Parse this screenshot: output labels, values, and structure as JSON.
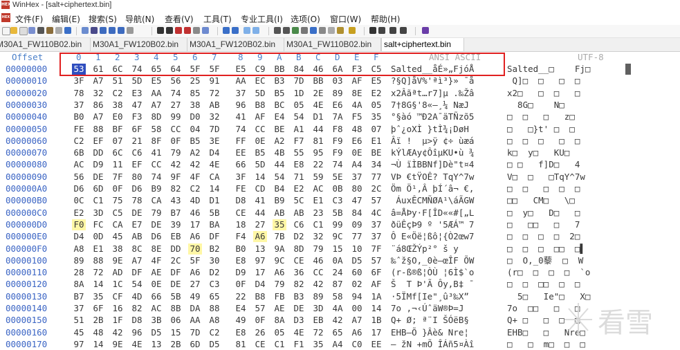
{
  "window": {
    "title": "WinHex - [salt+ciphertext.bin]"
  },
  "menu": [
    "文件(F)",
    "编辑(E)",
    "搜索(S)",
    "导航(N)",
    "查看(V)",
    "工具(T)",
    "专业工具(I)",
    "选项(O)",
    "窗口(W)",
    "帮助(H)"
  ],
  "tabs": [
    {
      "label": "M30A1_FW110B02.bin"
    },
    {
      "label": "M30A1_FW120B02.bin"
    },
    {
      "label": "M30A1_FW120B02.bin"
    },
    {
      "label": "M30A1_FW110B02.bin"
    },
    {
      "label": "salt+ciphertext.bin"
    }
  ],
  "header": {
    "offset_label": "Offset",
    "cols": [
      "0",
      "1",
      "2",
      "3",
      "4",
      "5",
      "6",
      "7",
      "8",
      "9",
      "A",
      "B",
      "C",
      "D",
      "E",
      "F"
    ],
    "ansi_label": "ANSI ASCII",
    "utf_label": "UTF-8"
  },
  "rows": [
    {
      "off": "00000000",
      "hex": [
        "53",
        "61",
        "6C",
        "74",
        "65",
        "64",
        "5F",
        "5F",
        "E5",
        "C9",
        "BB",
        "84",
        "46",
        "6A",
        "F3",
        "C5"
      ],
      "ansi": "Salted__åÉ»„FjóÅ",
      "utf": "Salted__□    Fj□"
    },
    {
      "off": "00000010",
      "hex": [
        "3F",
        "A7",
        "51",
        "5D",
        "E5",
        "56",
        "25",
        "91",
        "AA",
        "EC",
        "B3",
        "7D",
        "BB",
        "03",
        "AF",
        "E5"
      ],
      "ansi": "?§Q]åV%'ªì³}» ¯å",
      "utf": " Q]□  □   □  □"
    },
    {
      "off": "00000020",
      "hex": [
        "78",
        "32",
        "C2",
        "E3",
        "AA",
        "74",
        "85",
        "72",
        "37",
        "5D",
        "B5",
        "1D",
        "2E",
        "89",
        "8E",
        "E2"
      ],
      "ansi": "x2Âãªt…r7]µ .‰Žâ",
      "utf": "x2□   □  □   □"
    },
    {
      "off": "00000030",
      "hex": [
        "37",
        "86",
        "38",
        "47",
        "A7",
        "27",
        "38",
        "AB",
        "96",
        "B8",
        "BC",
        "05",
        "4E",
        "E6",
        "4A",
        "05"
      ],
      "ansi": "7†8G§'8«–¸¼ NæJ",
      "utf": "  8G□    N□"
    },
    {
      "off": "00000040",
      "hex": [
        "B0",
        "A7",
        "E0",
        "F3",
        "8D",
        "99",
        "D0",
        "32",
        "41",
        "AF",
        "E4",
        "54",
        "D1",
        "7A",
        "F5",
        "35"
      ],
      "ansi": "°§àó ™Ð2A¯äTÑzõ5",
      "utf": "□  □   □   z□"
    },
    {
      "off": "00000050",
      "hex": [
        "FE",
        "88",
        "BF",
        "6F",
        "58",
        "CC",
        "04",
        "7D",
        "74",
        "CC",
        "BE",
        "A1",
        "44",
        "F8",
        "48",
        "07"
      ],
      "ansi": "þˆ¿oXÌ }tÌ¾¡DøH",
      "utf": "□   □}t' □  □"
    },
    {
      "off": "00000060",
      "hex": [
        "C2",
        "EF",
        "07",
        "21",
        "8F",
        "0F",
        "B5",
        "3E",
        "FF",
        "0E",
        "A2",
        "F7",
        "81",
        "F9",
        "E6",
        "E1"
      ],
      "ansi": "Âï !  µ>ÿ ¢÷ ùæá",
      "utf": "□  □  □   □  □"
    },
    {
      "off": "00000070",
      "hex": [
        "6B",
        "DD",
        "6C",
        "C6",
        "41",
        "79",
        "A2",
        "D4",
        "EE",
        "B5",
        "4B",
        "55",
        "95",
        "F9",
        "0E",
        "BE"
      ],
      "ansi": "kÝlÆAy¢ÔîµKU•ù ¾",
      "utf": "k□  y□   KU□"
    },
    {
      "off": "00000080",
      "hex": [
        "AC",
        "D9",
        "11",
        "EF",
        "CC",
        "42",
        "42",
        "4E",
        "66",
        "5D",
        "44",
        "E8",
        "22",
        "74",
        "A4",
        "34"
      ],
      "ansi": "¬Ù ïÌBBNf]Dè\"t¤4",
      "utf": "□ □   f]D□   4"
    },
    {
      "off": "00000090",
      "hex": [
        "56",
        "DE",
        "7F",
        "80",
        "74",
        "9F",
        "4F",
        "CA",
        "3F",
        "14",
        "54",
        "71",
        "59",
        "5E",
        "37",
        "77"
      ],
      "ansi": "VÞ €tŸOÊ? TqY^7w",
      "utf": "V□  □   □TqY^7w"
    },
    {
      "off": "000000A0",
      "hex": [
        "D6",
        "6D",
        "0F",
        "D6",
        "B9",
        "82",
        "C2",
        "14",
        "FE",
        "CD",
        "B4",
        "E2",
        "AC",
        "0B",
        "80",
        "2C"
      ],
      "ansi": "Öm Ö¹‚Â þÍ´â¬ €,",
      "utf": "□  □   □  □  □"
    },
    {
      "off": "000000B0",
      "hex": [
        "0C",
        "C1",
        "75",
        "78",
        "CA",
        "43",
        "4D",
        "D1",
        "D8",
        "41",
        "B9",
        "5C",
        "E1",
        "C3",
        "47",
        "57"
      ],
      "ansi": " ÁuxÊCMÑØA¹\\áÃGW",
      "utf": "□□   CM□   \\□"
    },
    {
      "off": "000000C0",
      "hex": [
        "E2",
        "3D",
        "C5",
        "DE",
        "79",
        "B7",
        "46",
        "5B",
        "CE",
        "44",
        "AB",
        "AB",
        "23",
        "5B",
        "84",
        "4C"
      ],
      "ansi": "â=ÅÞy·F[ÎD««#[„L",
      "utf": "□  y□   D□   □"
    },
    {
      "off": "000000D0",
      "hex": [
        "F0",
        "FC",
        "CA",
        "E7",
        "DE",
        "39",
        "17",
        "BA",
        "18",
        "27",
        "35",
        "C6",
        "C1",
        "99",
        "09",
        "37"
      ],
      "ansi": "ðüÊçÞ9 º '5ÆÁ™ 7",
      "utf": "□   □□   □   7"
    },
    {
      "off": "000000E0",
      "hex": [
        "D4",
        "0D",
        "45",
        "AB",
        "D6",
        "EB",
        "A6",
        "DF",
        "F4",
        "A6",
        "7B",
        "D2",
        "32",
        "9C",
        "77",
        "37"
      ],
      "ansi": "Ô E«Öë¦ßô¦{Ò2œw7",
      "utf": "□  □  □  □  2□"
    },
    {
      "off": "000000F0",
      "hex": [
        "A8",
        "E1",
        "38",
        "8C",
        "8E",
        "DD",
        "70",
        "B2",
        "B0",
        "13",
        "9A",
        "8D",
        "79",
        "15",
        "10",
        "7F"
      ],
      "ansi": "¨á8ŒŽÝp²° š y  ",
      "utf": "□  □  □  □□  □▌"
    },
    {
      "off": "00000100",
      "hex": [
        "89",
        "88",
        "9E",
        "A7",
        "4F",
        "2C",
        "5F",
        "30",
        "E8",
        "97",
        "9C",
        "CE",
        "46",
        "0A",
        "D5",
        "57"
      ],
      "ansi": "‰ˆž§O,_0è—œÎF ÕW",
      "utf": "□  O,_0藜  □  W"
    },
    {
      "off": "00000110",
      "hex": [
        "28",
        "72",
        "AD",
        "DF",
        "AE",
        "DF",
        "A6",
        "D2",
        "D9",
        "17",
        "A6",
        "36",
        "CC",
        "24",
        "60",
        "6F"
      ],
      "ansi": "(r-ß®ß¦ÒÙ ¦6Ì$`o",
      "utf": "(r□  □  □  □  `o"
    },
    {
      "off": "00000120",
      "hex": [
        "8A",
        "14",
        "1C",
        "54",
        "0E",
        "DE",
        "27",
        "C3",
        "0F",
        "D4",
        "79",
        "82",
        "42",
        "87",
        "02",
        "AF"
      ],
      "ansi": "Š  T Þ'Ã Ôy‚B‡ ¯",
      "utf": "□  □  □□  □  □"
    },
    {
      "off": "00000130",
      "hex": [
        "B7",
        "35",
        "CF",
        "4D",
        "66",
        "5B",
        "49",
        "65",
        "22",
        "B8",
        "FB",
        "B3",
        "89",
        "58",
        "94",
        "1A"
      ],
      "ansi": "·5ÏMf[Ie\"¸û³‰X” ",
      "utf": "  5□   Ie\"□   X□"
    },
    {
      "off": "00000140",
      "hex": [
        "37",
        "6F",
        "16",
        "82",
        "AC",
        "8B",
        "DA",
        "88",
        "E4",
        "57",
        "AE",
        "DE",
        "3D",
        "4A",
        "00",
        "14"
      ],
      "ansi": "7o ‚¬‹ÚˆäW®Þ=J  ",
      "utf": "7o  □□   □   □"
    },
    {
      "off": "00000150",
      "hex": [
        "51",
        "2B",
        "1F",
        "D8",
        "3B",
        "06",
        "AA",
        "A8",
        "49",
        "0F",
        "8A",
        "D3",
        "EB",
        "42",
        "A7",
        "1B"
      ],
      "ansi": "Q+ Ø; ª¨I ŠÓëB§ ",
      "utf": "Q+ □   □  □  □"
    },
    {
      "off": "00000160",
      "hex": [
        "45",
        "48",
        "42",
        "96",
        "D5",
        "15",
        "7D",
        "C2",
        "E8",
        "26",
        "05",
        "4E",
        "72",
        "65",
        "A6",
        "17"
      ],
      "ansi": "EHB–Õ }Âè& Nre¦ ",
      "utf": "EHB□   □   Nre□"
    },
    {
      "off": "00000170",
      "hex": [
        "97",
        "14",
        "9E",
        "4E",
        "13",
        "2B",
        "6D",
        "D5",
        "81",
        "CE",
        "C1",
        "F1",
        "35",
        "A4",
        "C0",
        "EE"
      ],
      "ansi": "— žN +mÕ ÎÁñ5¤Àî",
      "utf": "□   □  m□  □  □"
    }
  ],
  "highlights": {
    "cursor": [
      0,
      0
    ],
    "yellow": [
      [
        13,
        0
      ],
      [
        13,
        10
      ],
      [
        14,
        9
      ],
      [
        15,
        6
      ]
    ]
  },
  "watermark": {
    "text": "看雪"
  }
}
